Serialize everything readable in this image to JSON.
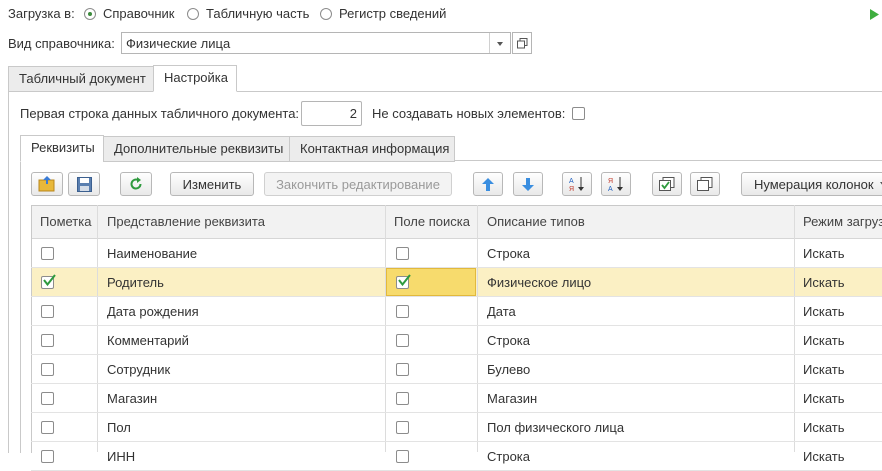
{
  "load_mode": {
    "label": "Загрузка в:",
    "options": [
      "Справочник",
      "Табличную часть",
      "Регистр сведений"
    ],
    "selected": "Справочник"
  },
  "catalog_type": {
    "label": "Вид справочника:",
    "value": "Физические лица"
  },
  "outer_tabs": [
    "Табличный документ",
    "Настройка"
  ],
  "active_outer_tab": "Настройка",
  "settings": {
    "first_row_label": "Первая строка данных табличного документа:",
    "first_row_value": "2",
    "no_new_label": "Не создавать новых элементов:"
  },
  "inner_tabs": [
    "Реквизиты",
    "Дополнительные реквизиты",
    "Контактная информация"
  ],
  "active_inner_tab": "Реквизиты",
  "toolbar": {
    "edit_label": "Изменить",
    "finish_label": "Закончить редактирование",
    "numbering_label": "Нумерация колонок"
  },
  "table": {
    "columns": [
      "Пометка",
      "Представление реквизита",
      "Поле поиска",
      "Описание типов",
      "Режим загруз"
    ],
    "rows": [
      {
        "mark": false,
        "name": "Наименование",
        "search": false,
        "type": "Строка",
        "mode": "Искать"
      },
      {
        "mark": true,
        "name": "Родитель",
        "search": true,
        "type": "Физическое лицо",
        "mode": "Искать"
      },
      {
        "mark": false,
        "name": "Дата рождения",
        "search": false,
        "type": "Дата",
        "mode": "Искать"
      },
      {
        "mark": false,
        "name": "Комментарий",
        "search": false,
        "type": "Строка",
        "mode": "Искать"
      },
      {
        "mark": false,
        "name": "Сотрудник",
        "search": false,
        "type": "Булево",
        "mode": "Искать"
      },
      {
        "mark": false,
        "name": "Магазин",
        "search": false,
        "type": "Магазин",
        "mode": "Искать"
      },
      {
        "mark": false,
        "name": "Пол",
        "search": false,
        "type": "Пол физического лица",
        "mode": "Искать"
      },
      {
        "mark": false,
        "name": "ИНН",
        "search": false,
        "type": "Строка",
        "mode": "Искать"
      }
    ],
    "selected_row": 1
  },
  "colors": {
    "accent_green": "#3d8b3d",
    "selected_row": "#fbf0c4",
    "focus_cell": "#f5d96a"
  }
}
